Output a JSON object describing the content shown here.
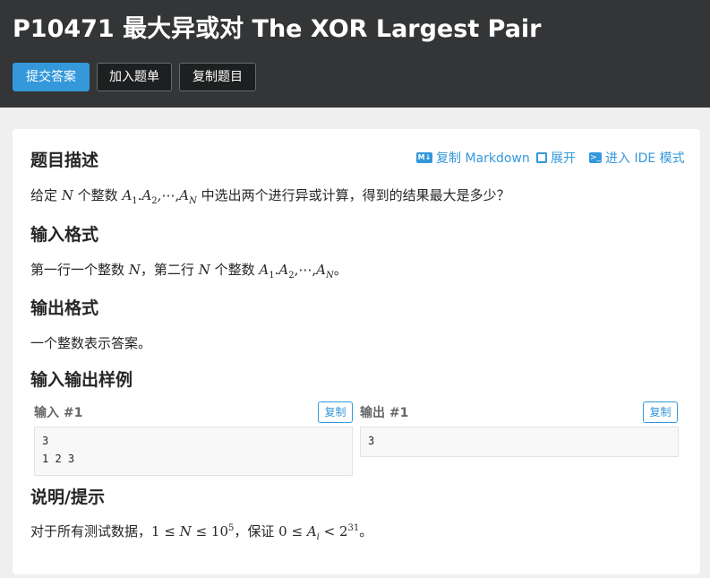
{
  "header": {
    "title": "P10471 最大异或对 The XOR Largest Pair",
    "buttons": {
      "submit": "提交答案",
      "add_to_list": "加入题单",
      "copy_problem": "复制题目"
    }
  },
  "toolbar": {
    "md_icon": "M↓",
    "copy_markdown": "复制 Markdown",
    "expand": "展开",
    "ide_icon": ">_",
    "ide_mode": "进入 IDE 模式"
  },
  "sections": {
    "description_title": "题目描述",
    "input_title": "输入格式",
    "output_title": "输出格式",
    "samples_title": "输入输出样例",
    "hint_title": "说明/提示"
  },
  "description": {
    "t1": "给定 ",
    "N": "N",
    "t2": " 个整数 ",
    "A": "A",
    "sub1": "1",
    "dot": ".",
    "sub2": "2",
    "dots": ",⋯,",
    "subN": "N",
    "t3": " 中选出两个进行异或计算，得到的结果最大是多少？"
  },
  "input_format": {
    "t1": "第一行一个整数 ",
    "N": "N",
    "t2": "，第二行 ",
    "t3": " 个整数 ",
    "end": "。"
  },
  "output_format": {
    "text": "一个整数表示答案。"
  },
  "samples": {
    "input_label": "输入 #1",
    "output_label": "输出 #1",
    "copy_label": "复制",
    "input_lines": [
      "3",
      "1 2 3"
    ],
    "output_lines": [
      "3"
    ]
  },
  "hint": {
    "t1": "对于所有测试数据，",
    "one": "1 ≤ ",
    "N": "N",
    "le": " ≤ 10",
    "exp5": "5",
    "t2": "，保证 ",
    "zero": "0 ≤ ",
    "A": "A",
    "i": "i",
    "lt": " < 2",
    "exp31": "31",
    "end": "。"
  }
}
